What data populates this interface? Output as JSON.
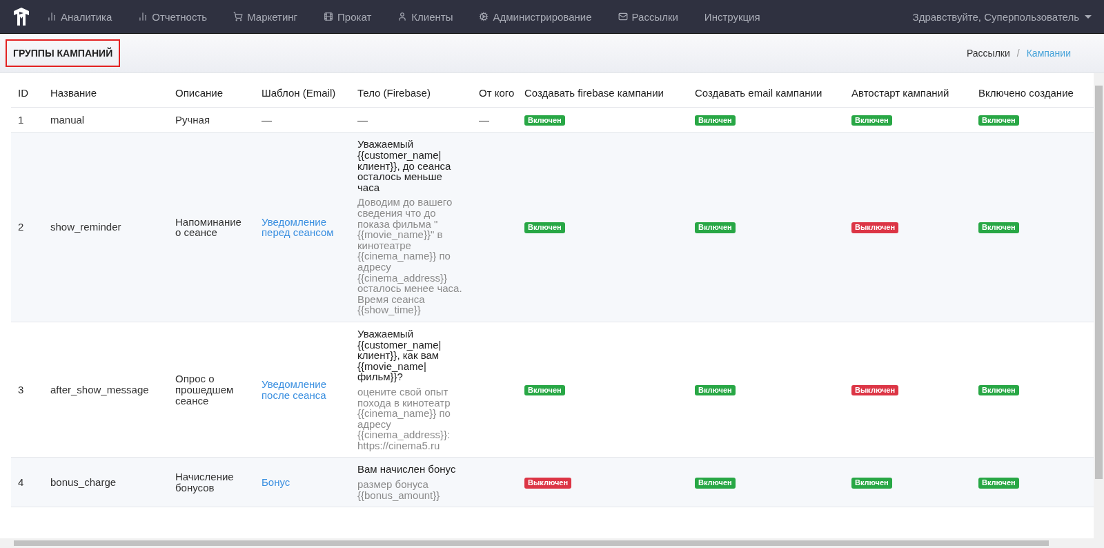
{
  "navbar": {
    "items": [
      {
        "label": "Аналитика"
      },
      {
        "label": "Отчетность"
      },
      {
        "label": "Маркетинг"
      },
      {
        "label": "Прокат"
      },
      {
        "label": "Клиенты"
      },
      {
        "label": "Администрирование"
      },
      {
        "label": "Рассылки"
      },
      {
        "label": "Инструкция"
      }
    ],
    "user": "Здравствуйте, Суперпользователь"
  },
  "page": {
    "title": "ГРУППЫ КАМПАНИЙ",
    "breadcrumb_separator": "/",
    "breadcrumbs": [
      {
        "label": "Рассылки",
        "selected": false
      },
      {
        "label": "Кампании",
        "selected": true
      }
    ]
  },
  "table": {
    "columns": [
      "ID",
      "Название",
      "Описание",
      "Шаблон (Email)",
      "Тело (Firebase)",
      "От кого",
      "Создавать firebase кампании",
      "Создавать email кампании",
      "Автостарт кампаний",
      "Включено создание"
    ],
    "rows": [
      {
        "id": "1",
        "name": "manual",
        "description": "Ручная",
        "template": {
          "kind": "text",
          "text": "—"
        },
        "body": {
          "kind": "text",
          "text": "—"
        },
        "from": "—",
        "flags": [
          {
            "label": "Включен",
            "on": true
          },
          {
            "label": "Включен",
            "on": true
          },
          {
            "label": "Включен",
            "on": true
          },
          {
            "label": "Включен",
            "on": true
          }
        ]
      },
      {
        "id": "2",
        "name": "show_reminder",
        "description": "Напоминание о сеансе",
        "template": {
          "kind": "link",
          "text": "Уведомление перед сеансом"
        },
        "body": {
          "kind": "message",
          "title": "Уважаемый {{customer_name|клиент}}, до сеанса осталось меньше часа",
          "text": "Доводим до вашего сведения что до показа фильма \"{{movie_name}}\" в кинотеатре {{cinema_name}} по адресу {{cinema_address}} осталось менее часа. Время сеанса {{show_time}}"
        },
        "from": "",
        "flags": [
          {
            "label": "Включен",
            "on": true
          },
          {
            "label": "Включен",
            "on": true
          },
          {
            "label": "Выключен",
            "on": false
          },
          {
            "label": "Включен",
            "on": true
          }
        ]
      },
      {
        "id": "3",
        "name": "after_show_message",
        "description": "Опрос о прошедшем сеансе",
        "template": {
          "kind": "link",
          "text": "Уведомление после сеанса"
        },
        "body": {
          "kind": "message",
          "title": "Уважаемый {{customer_name|клиент}}, как вам {{movie_name|фильм}}?",
          "text": "оцените свой опыт похода в кинотеатр {{cinema_name}} по адресу {{cinema_address}}: https://cinema5.ru"
        },
        "from": "",
        "flags": [
          {
            "label": "Включен",
            "on": true
          },
          {
            "label": "Включен",
            "on": true
          },
          {
            "label": "Выключен",
            "on": false
          },
          {
            "label": "Включен",
            "on": true
          }
        ]
      },
      {
        "id": "4",
        "name": "bonus_charge",
        "description": "Начисление бонусов",
        "template": {
          "kind": "link",
          "text": "Бонус"
        },
        "body": {
          "kind": "message",
          "title": "Вам начислен бонус",
          "text": "размер бонуса {{bonus_amount}}"
        },
        "from": "",
        "flags": [
          {
            "label": "Выключен",
            "on": false
          },
          {
            "label": "Включен",
            "on": true
          },
          {
            "label": "Включен",
            "on": true
          },
          {
            "label": "Включен",
            "on": true
          }
        ]
      }
    ]
  }
}
